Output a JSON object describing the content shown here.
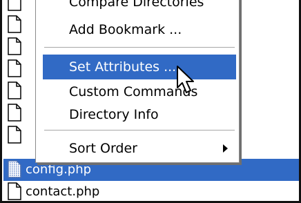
{
  "file_list": {
    "rows": [
      {
        "name": "",
        "selected": false
      },
      {
        "name": "",
        "selected": false
      },
      {
        "name": "",
        "selected": false
      },
      {
        "name": "",
        "selected": false
      },
      {
        "name": "",
        "selected": false
      },
      {
        "name": "",
        "selected": false
      },
      {
        "name": "",
        "selected": false
      },
      {
        "name": "config.php",
        "selected": true
      },
      {
        "name": "contact.php",
        "selected": false
      }
    ]
  },
  "context_menu": {
    "items": [
      {
        "label": "Compare Directories"
      },
      {
        "label": "Add Bookmark ..."
      },
      {
        "label": "Set Attributes ...",
        "highlighted": true
      },
      {
        "label": "Custom Commands"
      },
      {
        "label": "Directory Info"
      },
      {
        "label": "Sort Order",
        "submenu": true
      }
    ]
  },
  "colors": {
    "selection": "#316ac5",
    "selection_text": "#ffffff",
    "text": "#000000"
  },
  "icons": {
    "file": "document-icon",
    "php_file": "php-document-icon",
    "submenu": "chevron-right-icon",
    "cursor": "mouse-pointer-icon"
  }
}
